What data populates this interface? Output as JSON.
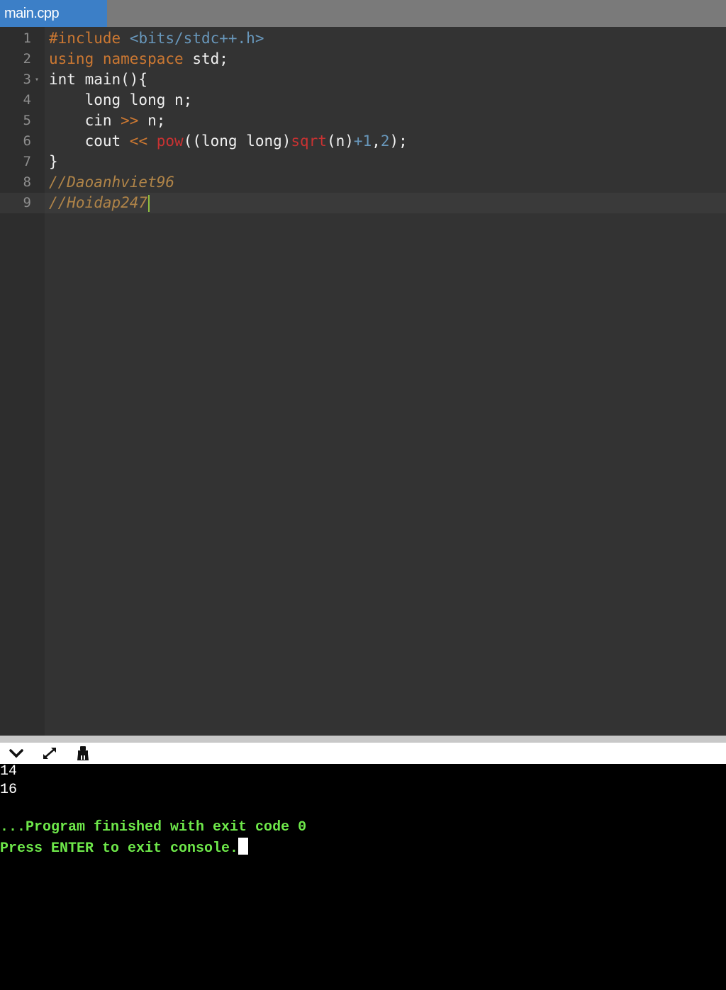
{
  "tab": {
    "label": "main.cpp"
  },
  "editor": {
    "line_numbers": [
      "1",
      "2",
      "3",
      "4",
      "5",
      "6",
      "7",
      "8",
      "9"
    ],
    "fold_marker": "▾",
    "lines": {
      "l1": {
        "directive": "#include",
        "header": "<bits/stdc++.h>"
      },
      "l2": {
        "kw1": "using",
        "kw2": "namespace",
        "rest": "std;"
      },
      "l3": {
        "text": "int main(){"
      },
      "l4": {
        "text": "    long long n;"
      },
      "l5": {
        "a": "    cin ",
        "op": ">>",
        "b": " n;"
      },
      "l6": {
        "a": "    cout ",
        "op": "<<",
        "sp": " ",
        "pow": "pow",
        "b": "((long long)",
        "sqrt": "sqrt",
        "c": "(n)",
        "plus": "+1",
        "comma": ",",
        "two": "2",
        "end": ");"
      },
      "l7": {
        "text": "}"
      },
      "l8": {
        "comment": "//Daoanhviet96"
      },
      "l9": {
        "comment": "//Hoidap247"
      }
    }
  },
  "console_toolbar": {
    "icons": [
      "chevron-down-icon",
      "expand-icon",
      "clear-console-icon"
    ]
  },
  "console": {
    "output": [
      "14",
      "16"
    ],
    "finish_msg": "...Program finished with exit code 0",
    "press_msg": "Press ENTER to exit console."
  },
  "colors": {
    "keyword": "#cc7832",
    "string": "#6897bb",
    "function": "#c93232",
    "comment": "#b08448",
    "console_message": "#6ee84a",
    "tab_active": "#3c7fc7"
  }
}
